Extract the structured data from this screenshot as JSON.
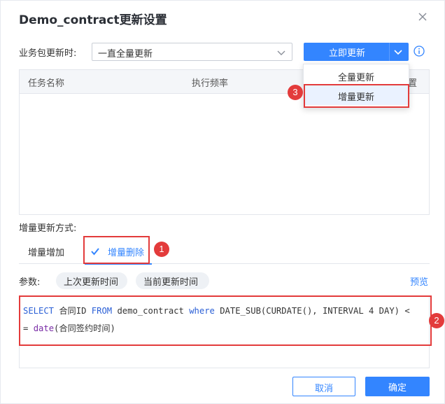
{
  "dialog": {
    "title": "Demo_contract更新设置"
  },
  "update_time": {
    "label": "业务包更新时:",
    "selected": "一直全量更新",
    "button_label": "立即更新"
  },
  "dropdown": {
    "items": [
      "全量更新",
      "增量更新"
    ]
  },
  "table": {
    "headers": [
      "任务名称",
      "执行频率",
      "置"
    ]
  },
  "increment": {
    "label": "增量更新方式:",
    "tabs": [
      "增量增加",
      "增量删除"
    ],
    "active_tab": "增量删除"
  },
  "params": {
    "label": "参数:",
    "chips": [
      "上次更新时间",
      "当前更新时间"
    ],
    "preview_label": "预览"
  },
  "sql": {
    "line1": {
      "kw_select": "SELECT",
      "col": " 合同ID ",
      "kw_from": "FROM",
      "table": " demo_contract ",
      "kw_where": "where",
      "rest": " DATE_SUB(CURDATE(), INTERVAL 4 DAY) <"
    },
    "line2": {
      "prefix": "= ",
      "fn": "date",
      "rest": "(合同签约时间)"
    }
  },
  "annotations": [
    "1",
    "2",
    "3"
  ],
  "footer": {
    "cancel_label": "取消",
    "ok_label": "确定"
  },
  "colors": {
    "primary": "#3385ff",
    "annotation": "#e33b3b",
    "keyword": "#2a5fd6",
    "function": "#7a2da6"
  }
}
